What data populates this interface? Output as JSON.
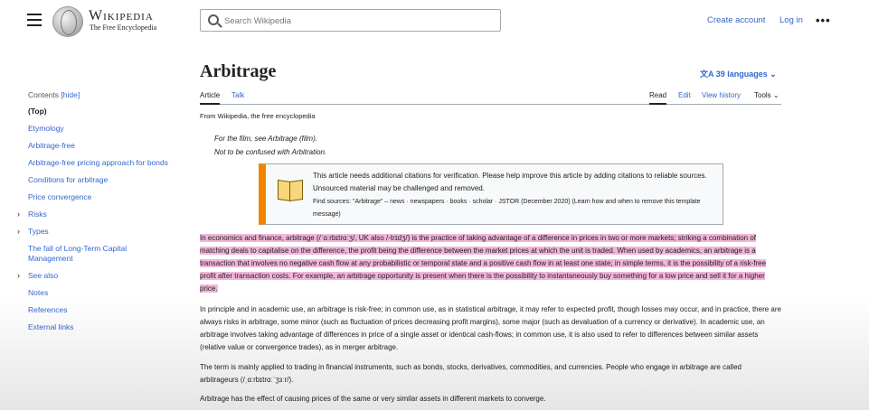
{
  "header": {
    "wordmark": "Wikipedia",
    "tagline": "The Free Encyclopedia",
    "search_placeholder": "Search Wikipedia",
    "create_account": "Create account",
    "log_in": "Log in",
    "more": "•••"
  },
  "sidebar": {
    "contents": "Contents",
    "hide": "[hide]",
    "items": [
      {
        "label": "(Top)"
      },
      {
        "label": "Etymology"
      },
      {
        "label": "Arbitrage-free"
      },
      {
        "label": "Arbitrage-free pricing approach for bonds"
      },
      {
        "label": "Conditions for arbitrage"
      },
      {
        "label": "Price convergence"
      },
      {
        "label": "Risks"
      },
      {
        "label": "Types"
      },
      {
        "label": "The fall of Long-Term Capital Management"
      },
      {
        "label": "See also"
      },
      {
        "label": "Notes"
      },
      {
        "label": "References"
      },
      {
        "label": "External links"
      }
    ]
  },
  "article": {
    "title": "Arbitrage",
    "languages": "39 languages",
    "tabs": [
      "Article",
      "Talk",
      "Read",
      "Edit",
      "View history",
      "Tools"
    ],
    "from": "From Wikipedia, the free encyclopedia",
    "hatnote1": "For the film, see Arbitrage (film).",
    "hatnote2": "Not to be confused with Arbitration.",
    "ambox_line1": "This article needs additional citations for verification. Please help improve this article by adding citations to reliable sources. Unsourced material may be challenged and removed.",
    "ambox_line2": "Find sources: \"Arbitrage\" – news · newspapers · books · scholar · JSTOR (December 2020) (Learn how and when to remove this template message)",
    "para1": "In economics and finance, arbitrage (/ˈɑːrbɪtrɑːʒ/, UK also /-trɪdʒ/) is the practice of taking advantage of a difference in prices in two or more markets; striking a combination of matching deals to capitalise on the difference, the profit being the difference between the market prices at which the unit is traded. When used by academics, an arbitrage is a transaction that involves no negative cash flow at any probabilistic or temporal state and a positive cash flow in at least one state; in simple terms, it is the possibility of a risk-free profit after transaction costs. For example, an arbitrage opportunity is present when there is the possibility to instantaneously buy something for a low price and sell it for a higher price.",
    "para2": "In principle and in academic use, an arbitrage is risk-free; in common use, as in statistical arbitrage, it may refer to expected profit, though losses may occur, and in practice, there are always risks in arbitrage, some minor (such as fluctuation of prices decreasing profit margins), some major (such as devaluation of a currency or derivative). In academic use, an arbitrage involves taking advantage of differences in price of a single asset or identical cash-flows; in common use, it is also used to refer to differences between similar assets (relative value or convergence trades), as in merger arbitrage.",
    "para3": "The term is mainly applied to trading in financial instruments, such as bonds, stocks, derivatives, commodities, and currencies. People who engage in arbitrage are called arbitrageurs (/ˌɑːrbɪtrɑːˈʒɜːr/).",
    "para4": "Arbitrage has the effect of causing prices of the same or very similar assets in different markets to converge."
  },
  "colors": {
    "link": "#3366cc",
    "highlight": "#f2b6da",
    "ambox_bar": "#f28500"
  }
}
